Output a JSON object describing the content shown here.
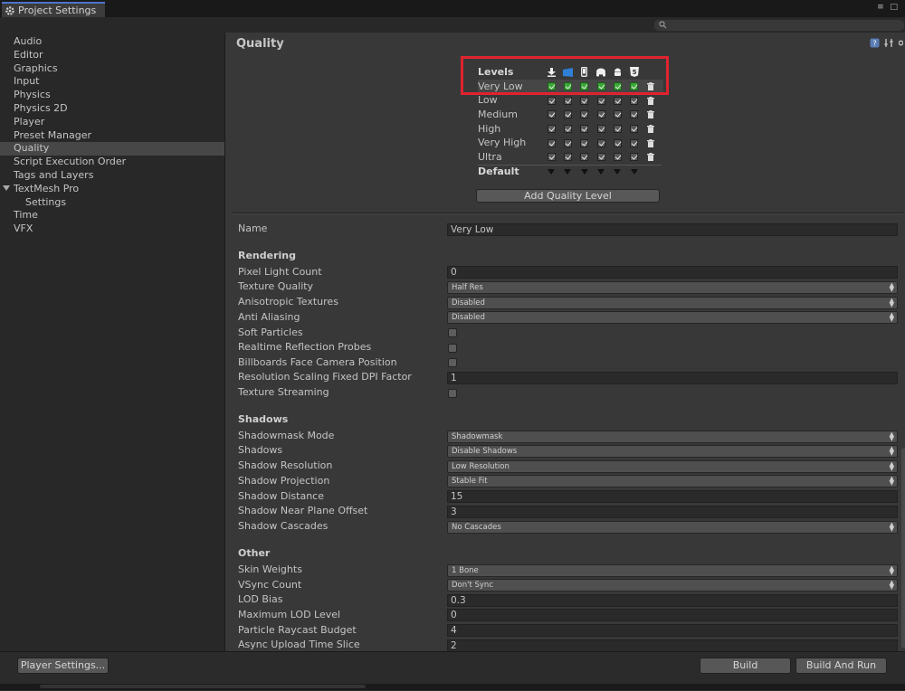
{
  "window": {
    "tab_title": "Project Settings",
    "controls": "≡ □"
  },
  "sidebar": {
    "items": [
      {
        "label": "Audio"
      },
      {
        "label": "Editor"
      },
      {
        "label": "Graphics"
      },
      {
        "label": "Input"
      },
      {
        "label": "Physics"
      },
      {
        "label": "Physics 2D"
      },
      {
        "label": "Player"
      },
      {
        "label": "Preset Manager"
      },
      {
        "label": "Quality",
        "selected": true
      },
      {
        "label": "Script Execution Order"
      },
      {
        "label": "Tags and Layers"
      },
      {
        "label": "TextMesh Pro",
        "expanded": true
      },
      {
        "label": "Settings",
        "child": true
      },
      {
        "label": "Time"
      },
      {
        "label": "VFX"
      }
    ]
  },
  "header": {
    "title": "Quality"
  },
  "levels": {
    "heading": "Levels",
    "platform_icons": [
      "download-icon",
      "windows-store-icon",
      "mobile-icon",
      "ps4-icon",
      "android-icon",
      "html5-icon"
    ],
    "rows": [
      {
        "name": "Very Low",
        "selected": true
      },
      {
        "name": "Low"
      },
      {
        "name": "Medium"
      },
      {
        "name": "High"
      },
      {
        "name": "Very High"
      },
      {
        "name": "Ultra"
      }
    ],
    "default_label": "Default",
    "add_button": "Add Quality Level"
  },
  "props": {
    "name_label": "Name",
    "name_value": "Very Low",
    "rendering": "Rendering",
    "pixel_light_count": "Pixel Light Count",
    "pixel_light_count_value": "0",
    "texture_quality": "Texture Quality",
    "texture_quality_value": "Half Res",
    "anisotropic": "Anisotropic Textures",
    "anisotropic_value": "Disabled",
    "anti_aliasing": "Anti Aliasing",
    "anti_aliasing_value": "Disabled",
    "soft_particles": "Soft Particles",
    "realtime_reflection": "Realtime Reflection Probes",
    "billboards": "Billboards Face Camera Position",
    "resolution_scaling": "Resolution Scaling Fixed DPI Factor",
    "resolution_scaling_value": "1",
    "texture_streaming": "Texture Streaming",
    "shadows_section": "Shadows",
    "shadowmask_mode": "Shadowmask Mode",
    "shadowmask_mode_value": "Shadowmask",
    "shadows": "Shadows",
    "shadows_value": "Disable Shadows",
    "shadow_resolution": "Shadow Resolution",
    "shadow_resolution_value": "Low Resolution",
    "shadow_projection": "Shadow Projection",
    "shadow_projection_value": "Stable Fit",
    "shadow_distance": "Shadow Distance",
    "shadow_distance_value": "15",
    "shadow_near_plane": "Shadow Near Plane Offset",
    "shadow_near_plane_value": "3",
    "shadow_cascades": "Shadow Cascades",
    "shadow_cascades_value": "No Cascades",
    "other_section": "Other",
    "skin_weights": "Skin Weights",
    "skin_weights_value": "1 Bone",
    "vsync": "VSync Count",
    "vsync_value": "Don't Sync",
    "lod_bias": "LOD Bias",
    "lod_bias_value": "0.3",
    "max_lod": "Maximum LOD Level",
    "max_lod_value": "0",
    "particle_raycast": "Particle Raycast Budget",
    "particle_raycast_value": "4",
    "async_upload": "Async Upload Time Slice",
    "async_upload_value": "2"
  },
  "footer": {
    "player_settings": "Player Settings...",
    "build": "Build",
    "build_and_run": "Build And Run"
  },
  "colors": {
    "highlight": "#e0232f",
    "checkbox_green": "#3aa935",
    "tab_accent": "#4d74c9"
  }
}
